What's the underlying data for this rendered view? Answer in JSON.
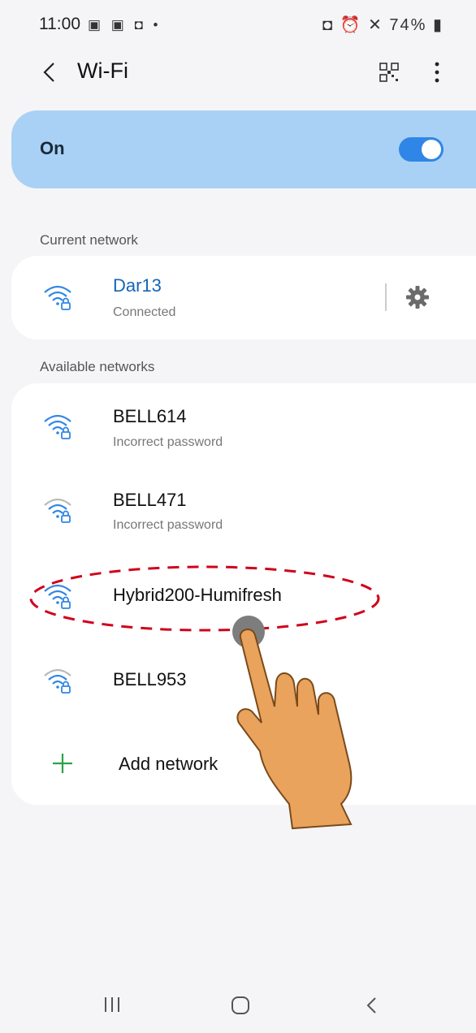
{
  "status_bar": {
    "time": "11:00",
    "left_icons": "▣ ▣ ◘ •",
    "right_icons": "◘ ⏰ ✕ ",
    "battery": "74%"
  },
  "header": {
    "title": "Wi-Fi",
    "back_icon": "chevron-left-icon",
    "qr_icon": "qr-code-icon",
    "more_icon": "more-vert-icon"
  },
  "wifi_toggle": {
    "label": "On",
    "state": true,
    "accent": "#2f86e6"
  },
  "current_network": {
    "section_label": "Current network",
    "name": "Dar13",
    "status": "Connected"
  },
  "available_networks": {
    "section_label": "Available networks",
    "items": [
      {
        "name": "BELL614",
        "status": "Incorrect password"
      },
      {
        "name": "BELL471",
        "status": "Incorrect password"
      },
      {
        "name": "Hybrid200-Humifresh",
        "status": ""
      },
      {
        "name": "BELL953",
        "status": ""
      }
    ],
    "add_label": "Add network"
  },
  "colors": {
    "background": "#f5f5f7",
    "on_card": "#a9d1f5",
    "connected_name": "#1566b8",
    "annotation": "#d0021b",
    "hand": "#e9a35c"
  }
}
